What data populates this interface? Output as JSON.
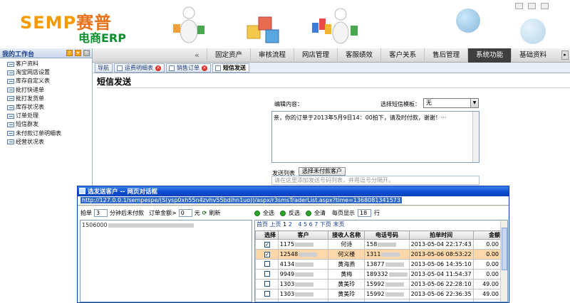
{
  "header": {
    "logo_brand": "SEMP",
    "logo_cn": "赛普",
    "logo_sub": "电商ERP"
  },
  "nav": {
    "items": [
      {
        "label": "固定资产",
        "active": false
      },
      {
        "label": "审核流程",
        "active": false
      },
      {
        "label": "网店管理",
        "active": false
      },
      {
        "label": "客服绩效",
        "active": false
      },
      {
        "label": "客户关系",
        "active": false
      },
      {
        "label": "售后管理",
        "active": false
      },
      {
        "label": "系统功能",
        "active": true
      },
      {
        "label": "基础资料",
        "active": false
      }
    ]
  },
  "sidebar": {
    "title": "我的工作台",
    "items": [
      "客户资料",
      "淘宝网店设置",
      "库存自定义表",
      "批打快递单",
      "批打发货单",
      "库存状况表",
      "订单处理",
      "短信群发",
      "未付款订单明细表",
      "经营状况表"
    ]
  },
  "tabs": [
    {
      "label": "导航",
      "closable": false,
      "active": false
    },
    {
      "label": "运费明细表",
      "closable": true,
      "active": false
    },
    {
      "label": "销售订单",
      "closable": true,
      "active": false
    },
    {
      "label": "短信发送",
      "closable": false,
      "active": true
    }
  ],
  "main": {
    "title": "短信发送",
    "edit_label": "编辑内容：",
    "template_label": "选择短信模板：",
    "template_value": "无",
    "message": "亲，你的订单于2013年5月9日14：00拍下，请及时付款，谢谢！···",
    "contacts_label": "发送列表",
    "select_unpaid_button": "选择未付款客户",
    "contacts_placeholder": "请在这里添加发送号码列表，并用逗号分隔开。"
  },
  "dialog": {
    "title": "选发送客户 -- 网页对话框",
    "url": "http://127.0.0.1/sempespe/(S(ysp0xh55n4zvhv55bdihn1uo))/aspx/r3smsTraderList.aspx?time=1368081341573",
    "toolbar": {
      "prefix": "拍单",
      "minutes_value": "3",
      "minutes_suffix": "分钟后未付款",
      "amount_label": "订单金额>",
      "amount_value": "0",
      "amount_unit": "元",
      "refresh": "刷新"
    },
    "left_text": "1506000",
    "actions": {
      "select_all": "全选",
      "invert": "反选",
      "clear": "全清",
      "per_page_label": "每页显示",
      "per_page_value": "18",
      "per_page_unit": "行"
    },
    "pager": {
      "first": "首页",
      "prev": "上页",
      "page1": "1",
      "page2": "2",
      "pages_rest": "4 5 6 7",
      "next": "下页",
      "last": "末页"
    },
    "columns": [
      "选择",
      "客户",
      "接收人名称",
      "电话号码",
      "拍单时间",
      "金额"
    ],
    "rows": [
      {
        "checked": true,
        "customer": "1175",
        "name": "何诗",
        "phone": "158",
        "time": "2013-05-04 22:17:43",
        "amount": "0.00",
        "highlight": false
      },
      {
        "checked": true,
        "customer": "12548",
        "name": "何义楼",
        "phone": "1311",
        "time": "2013-05-06 08:53:22",
        "amount": "0.00",
        "highlight": true
      },
      {
        "checked": false,
        "customer": "4134",
        "name": "黄海燕",
        "phone": "13877",
        "time": "2013-05-06 14:35:10",
        "amount": "0.00",
        "highlight": false
      },
      {
        "checked": false,
        "customer": "9949",
        "name": "黄梅",
        "phone": "189332",
        "time": "2013-05-04 11:54:37",
        "amount": "0.00",
        "highlight": false
      },
      {
        "checked": false,
        "customer": "1303",
        "name": "黄美玲",
        "phone": "15992",
        "time": "2013-05-06 22:28:10",
        "amount": "49.00",
        "highlight": false
      },
      {
        "checked": false,
        "customer": "1303",
        "name": "黄美玲",
        "phone": "15992",
        "time": "2013-05-06 22:36:35",
        "amount": "49.00",
        "highlight": false
      },
      {
        "checked": false,
        "customer": "",
        "name": "",
        "phone": "",
        "time": "",
        "amount": "",
        "highlight": false
      }
    ]
  }
}
